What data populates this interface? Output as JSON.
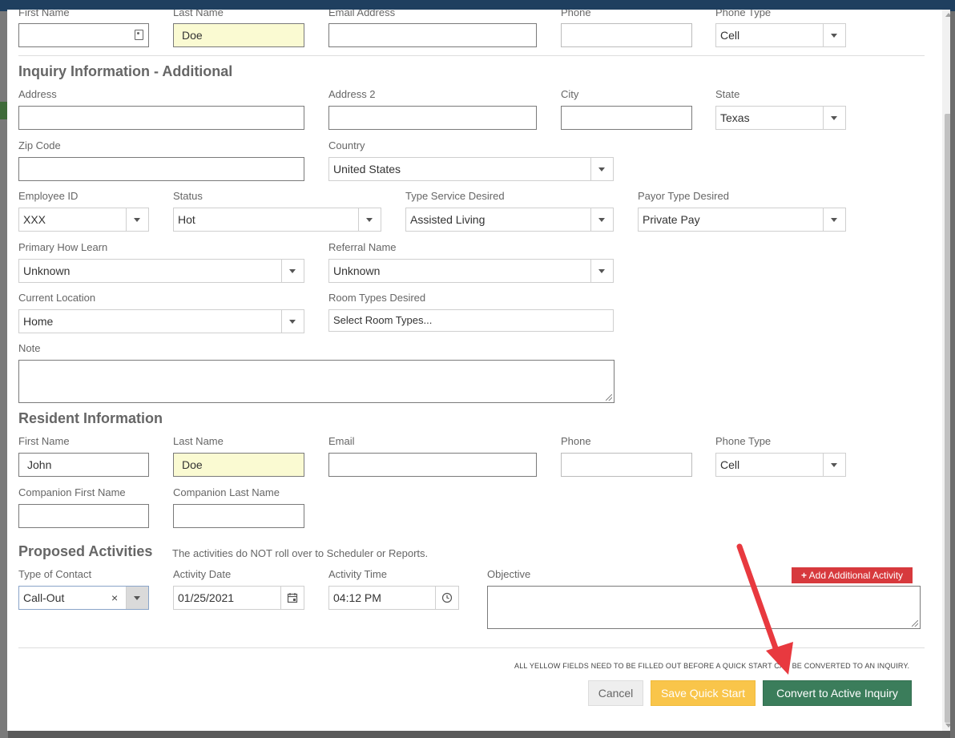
{
  "contact": {
    "first_name_label": "First Name",
    "last_name_label": "Last Name",
    "last_name_value": "Doe",
    "email_label": "Email Address",
    "phone_label": "Phone",
    "phone_type_label": "Phone Type",
    "phone_type_value": "Cell"
  },
  "additional": {
    "title": "Inquiry Information - Additional",
    "address_label": "Address",
    "address2_label": "Address 2",
    "city_label": "City",
    "state_label": "State",
    "state_value": "Texas",
    "zip_label": "Zip Code",
    "country_label": "Country",
    "country_value": "United States",
    "employee_id_label": "Employee ID",
    "employee_id_value": "XXX",
    "status_label": "Status",
    "status_value": "Hot",
    "type_service_label": "Type Service Desired",
    "type_service_value": "Assisted Living",
    "payor_type_label": "Payor Type Desired",
    "payor_type_value": "Private Pay",
    "primary_how_learn_label": "Primary How Learn",
    "primary_how_learn_value": "Unknown",
    "referral_name_label": "Referral Name",
    "referral_name_value": "Unknown",
    "current_location_label": "Current Location",
    "current_location_value": "Home",
    "room_types_label": "Room Types Desired",
    "room_types_placeholder": "Select Room Types...",
    "note_label": "Note"
  },
  "resident": {
    "title": "Resident Information",
    "first_name_label": "First Name",
    "first_name_value": "John",
    "last_name_label": "Last Name",
    "last_name_value": "Doe",
    "email_label": "Email",
    "phone_label": "Phone",
    "phone_type_label": "Phone Type",
    "phone_type_value": "Cell",
    "companion_first_label": "Companion First Name",
    "companion_last_label": "Companion Last Name"
  },
  "activities": {
    "title": "Proposed Activities",
    "description": "The activities do NOT roll over to Scheduler or Reports.",
    "type_contact_label": "Type of Contact",
    "type_contact_value": "Call-Out",
    "clear_symbol": "×",
    "activity_date_label": "Activity Date",
    "activity_date_value": "01/25/2021",
    "activity_time_label": "Activity Time",
    "activity_time_value": "04:12 PM",
    "objective_label": "Objective",
    "add_button_label": "Add Additional Activity",
    "add_button_icon": "+"
  },
  "footer": {
    "notice": "ALL YELLOW FIELDS NEED TO BE FILLED OUT BEFORE A QUICK START CAN BE CONVERTED TO AN INQUIRY.",
    "cancel_label": "Cancel",
    "save_label": "Save Quick Start",
    "convert_label": "Convert to Active Inquiry"
  },
  "colors": {
    "required_field_bg": "#fafad2",
    "convert_button": "#3b7d5b",
    "save_button": "#f9c54a",
    "add_button": "#d7393d",
    "annotation_arrow": "#e8393f"
  },
  "icons": {
    "contact_card": "contact-card-icon",
    "calendar": "calendar-icon",
    "clock": "clock-icon",
    "dropdown": "chevron-down-icon",
    "plus": "plus-icon"
  }
}
